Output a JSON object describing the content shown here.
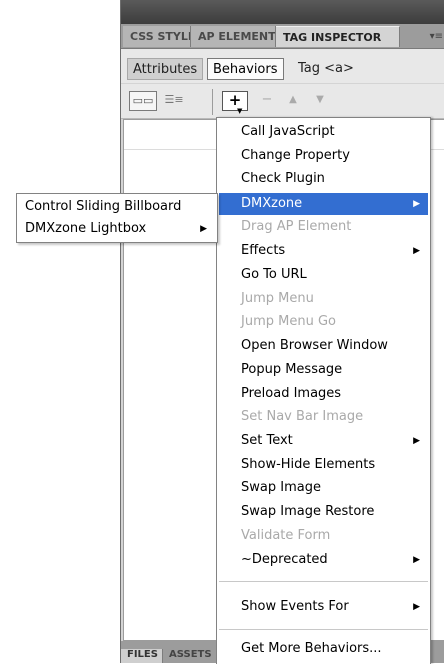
{
  "panel": {
    "tabs": [
      "CSS STYLES",
      "AP ELEMENTS",
      "TAG INSPECTOR"
    ],
    "subtabs": {
      "attributes": "Attributes",
      "behaviors": "Behaviors",
      "tag": "Tag <a>"
    },
    "toolbar": {
      "add_symbol": "+",
      "remove_symbol": "−",
      "up_symbol": "▲",
      "down_symbol": "▼"
    },
    "bottom_tabs": [
      "FILES",
      "ASSETS"
    ]
  },
  "main_menu": {
    "items": [
      {
        "label": "Call JavaScript",
        "disabled": false
      },
      {
        "label": "Change Property",
        "disabled": false
      },
      {
        "label": "Check Plugin",
        "disabled": false
      },
      {
        "label": "DMXzone",
        "disabled": false,
        "submenu": true,
        "highlighted": true
      },
      {
        "label": "Drag AP Element",
        "disabled": true
      },
      {
        "label": "Effects",
        "disabled": false,
        "submenu": true
      },
      {
        "label": "Go To URL",
        "disabled": false
      },
      {
        "label": "Jump Menu",
        "disabled": true
      },
      {
        "label": "Jump Menu Go",
        "disabled": true
      },
      {
        "label": "Open Browser Window",
        "disabled": false
      },
      {
        "label": "Popup Message",
        "disabled": false
      },
      {
        "label": "Preload Images",
        "disabled": false
      },
      {
        "label": "Set Nav Bar Image",
        "disabled": true
      },
      {
        "label": "Set Text",
        "disabled": false,
        "submenu": true
      },
      {
        "label": "Show-Hide Elements",
        "disabled": false
      },
      {
        "label": "Swap Image",
        "disabled": false
      },
      {
        "label": "Swap Image Restore",
        "disabled": false
      },
      {
        "label": "Validate Form",
        "disabled": true
      },
      {
        "label": "~Deprecated",
        "disabled": false,
        "submenu": true
      },
      {
        "label": "Show Events For",
        "disabled": false,
        "submenu": true
      },
      {
        "label": "Get More Behaviors...",
        "disabled": false
      }
    ]
  },
  "sub_menu": {
    "items": [
      {
        "label": "Control Sliding Billboard",
        "submenu": false
      },
      {
        "label": "DMXzone Lightbox",
        "submenu": true
      }
    ]
  },
  "colors": {
    "highlight": "#336ed1",
    "disabled_text": "#a9a9a9"
  }
}
